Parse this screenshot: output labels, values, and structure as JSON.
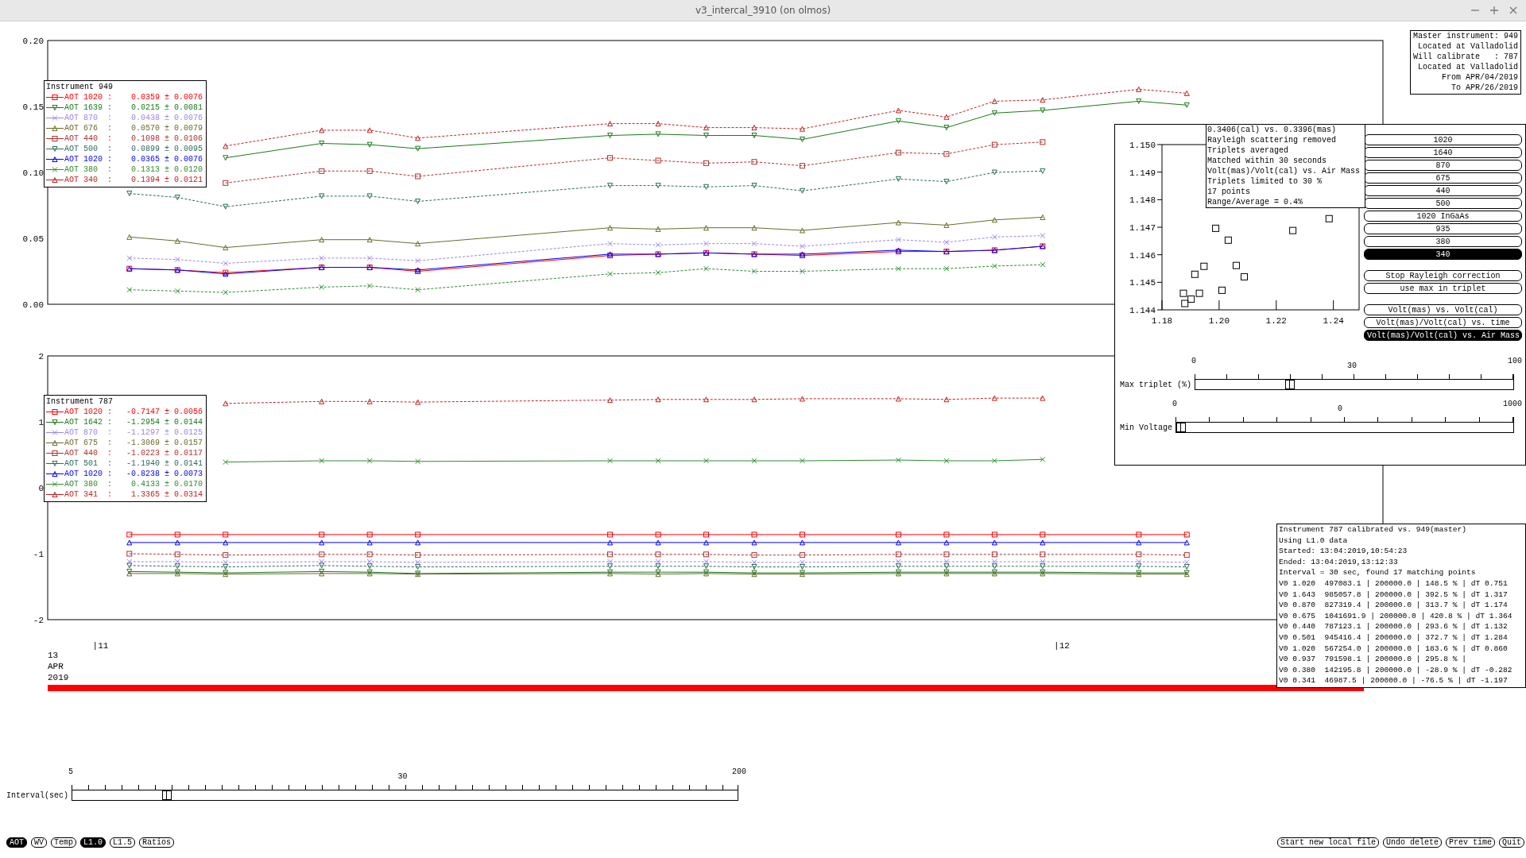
{
  "window": {
    "title": "v3_intercal_3910 (on olmos)"
  },
  "top_plot": {
    "chart_data": {
      "type": "line",
      "xlim": [
        10.945,
        12.334
      ],
      "ylim": [
        0,
        0.2
      ],
      "yticks": [
        {
          "value": 0,
          "label": "0.00"
        },
        {
          "value": 0.05,
          "label": "0.05"
        },
        {
          "value": 0.1,
          "label": "0.10"
        },
        {
          "value": 0.15,
          "label": "0.15"
        },
        {
          "value": 0.2,
          "label": "0.20"
        }
      ],
      "x": [
        11.03,
        11.08,
        11.13,
        11.23,
        11.28,
        11.33,
        11.53,
        11.58,
        11.63,
        11.68,
        11.73,
        11.83,
        11.88,
        11.93,
        11.98,
        12.08,
        12.13
      ],
      "series": [
        {
          "name": "AOT 1020",
          "color": "#ff0000",
          "marker": "square",
          "line_style": "solid",
          "values": [
            0.027,
            0.026,
            0.024,
            0.028,
            0.028,
            0.025,
            0.037,
            0.038,
            0.039,
            0.038,
            0.037,
            0.04,
            0.04,
            0.041,
            0.044,
            null,
            null
          ]
        },
        {
          "name": "AOT 1639",
          "color": "#1a7a1a",
          "marker": "triangle_down",
          "line_style": "solid",
          "values": [
            null,
            null,
            0.111,
            0.122,
            0.121,
            0.118,
            0.128,
            0.129,
            0.128,
            0.128,
            0.125,
            0.139,
            0.134,
            0.145,
            0.147,
            0.154,
            0.151
          ]
        },
        {
          "name": "AOT 870",
          "color": "#9b84ee",
          "marker": "x",
          "line_style": "dashed",
          "values": [
            0.035,
            0.034,
            0.031,
            0.035,
            0.035,
            0.033,
            0.046,
            0.045,
            0.046,
            0.046,
            0.044,
            0.049,
            0.047,
            0.051,
            0.052,
            null,
            null
          ]
        },
        {
          "name": "AOT 676",
          "color": "#6b6b2b",
          "marker": "triangle_up",
          "line_style": "solid",
          "values": [
            0.051,
            0.048,
            0.043,
            0.049,
            0.049,
            0.046,
            0.058,
            0.057,
            0.058,
            0.058,
            0.056,
            0.062,
            0.06,
            0.064,
            0.066,
            null,
            null
          ]
        },
        {
          "name": "AOT 440",
          "color": "#b03030",
          "marker": "square",
          "line_style": "dashed",
          "values": [
            null,
            null,
            0.092,
            0.101,
            0.101,
            0.097,
            0.111,
            0.109,
            0.107,
            0.108,
            0.105,
            0.115,
            0.114,
            0.121,
            0.123,
            null,
            null
          ]
        },
        {
          "name": "AOT 500",
          "color": "#2d6b5a",
          "marker": "triangle_down",
          "line_style": "dashed",
          "values": [
            0.084,
            0.081,
            0.074,
            0.082,
            0.082,
            0.078,
            0.09,
            0.09,
            0.089,
            0.09,
            0.086,
            0.095,
            0.093,
            0.1,
            0.101,
            null,
            null
          ]
        },
        {
          "name": "AOT 1020",
          "color": "#0000ff",
          "marker": "triangle_up",
          "line_style": "solid",
          "values": [
            0.027,
            0.026,
            0.023,
            0.028,
            0.028,
            0.026,
            0.038,
            0.038,
            0.039,
            0.038,
            0.038,
            0.041,
            0.04,
            0.041,
            0.044,
            null,
            null
          ]
        },
        {
          "name": "AOT 380",
          "color": "#2e8b2e",
          "marker": "x",
          "line_style": "dashed",
          "values": [
            0.011,
            0.01,
            0.009,
            0.013,
            0.014,
            0.011,
            0.023,
            0.024,
            0.027,
            0.025,
            0.025,
            0.027,
            0.027,
            0.029,
            0.03,
            null,
            null
          ]
        },
        {
          "name": "AOT 340",
          "color": "#c02020",
          "marker": "triangle_up",
          "line_style": "dashed",
          "values": [
            null,
            null,
            0.12,
            0.132,
            0.132,
            0.126,
            0.137,
            0.137,
            0.134,
            0.134,
            0.133,
            0.147,
            0.142,
            0.154,
            0.155,
            0.163,
            0.16
          ]
        }
      ]
    },
    "legend": {
      "title": "Instrument 949",
      "entries": [
        {
          "separator": ":",
          "value": "0.0359 ± 0.0076"
        },
        {
          "separator": ":",
          "value": "0.0215 ± 0.0081"
        },
        {
          "separator": ":",
          "value": "0.0438 ± 0.0076"
        },
        {
          "separator": ":",
          "value": "0.0570 ± 0.0079"
        },
        {
          "separator": ":",
          "value": "0.1098 ± 0.0106"
        },
        {
          "separator": ":",
          "value": "0.0899 ± 0.0095"
        },
        {
          "separator": ":",
          "value": "0.0365 ± 0.0076"
        },
        {
          "separator": ":",
          "value": "0.1313 ± 0.0120"
        },
        {
          "separator": ":",
          "value": "0.1394 ± 0.0121"
        }
      ]
    }
  },
  "bottom_plot": {
    "chart_data": {
      "type": "line",
      "xlim": [
        10.945,
        12.334
      ],
      "ylim": [
        -2,
        2
      ],
      "yticks": [
        -2,
        -1,
        0,
        1,
        2
      ],
      "xticks": [
        {
          "value": 11,
          "label": "|11"
        },
        {
          "value": 12,
          "label": "|12"
        }
      ],
      "x": [
        11.03,
        11.08,
        11.13,
        11.23,
        11.28,
        11.33,
        11.53,
        11.58,
        11.63,
        11.68,
        11.73,
        11.83,
        11.88,
        11.93,
        11.98,
        12.08,
        12.13
      ],
      "series": [
        {
          "name": "AOT 1020",
          "color": "#ff0000",
          "marker": "square",
          "line_style": "solid",
          "values": [
            -0.71,
            -0.71,
            -0.71,
            -0.71,
            -0.71,
            -0.71,
            -0.71,
            -0.71,
            -0.71,
            -0.71,
            -0.71,
            -0.71,
            -0.71,
            -0.71,
            -0.71,
            -0.71,
            -0.71
          ]
        },
        {
          "name": "AOT 1642",
          "color": "#1a7a1a",
          "marker": "triangle_down",
          "line_style": "solid",
          "values": [
            -1.27,
            -1.28,
            -1.29,
            -1.27,
            -1.28,
            -1.3,
            -1.28,
            -1.28,
            -1.28,
            -1.29,
            -1.29,
            -1.28,
            -1.28,
            -1.28,
            -1.28,
            -1.29,
            -1.29
          ]
        },
        {
          "name": "AOT 870",
          "color": "#9b84ee",
          "marker": "x",
          "line_style": "dashed",
          "values": [
            -1.12,
            -1.12,
            -1.13,
            -1.12,
            -1.12,
            -1.13,
            -1.12,
            -1.12,
            -1.12,
            -1.13,
            -1.13,
            -1.12,
            -1.12,
            -1.12,
            -1.12,
            -1.12,
            -1.13
          ]
        },
        {
          "name": "AOT 675",
          "color": "#6b6b2b",
          "marker": "triangle_up",
          "line_style": "solid",
          "values": [
            -1.3,
            -1.3,
            -1.31,
            -1.3,
            -1.3,
            -1.31,
            -1.3,
            -1.31,
            -1.3,
            -1.31,
            -1.31,
            -1.3,
            -1.3,
            -1.3,
            -1.3,
            -1.31,
            -1.31
          ]
        },
        {
          "name": "AOT 440",
          "color": "#b03030",
          "marker": "square",
          "line_style": "dashed",
          "values": [
            -1.0,
            -1.01,
            -1.02,
            -1.01,
            -1.01,
            -1.02,
            -1.01,
            -1.01,
            -1.01,
            -1.02,
            -1.02,
            -1.01,
            -1.01,
            -1.01,
            -1.01,
            -1.01,
            -1.02
          ]
        },
        {
          "name": "AOT 501",
          "color": "#2d6b5a",
          "marker": "triangle_down",
          "line_style": "dashed",
          "values": [
            -1.18,
            -1.19,
            -1.2,
            -1.18,
            -1.19,
            -1.2,
            -1.19,
            -1.19,
            -1.19,
            -1.2,
            -1.2,
            -1.19,
            -1.19,
            -1.19,
            -1.19,
            -1.19,
            -1.2
          ]
        },
        {
          "name": "AOT 1020",
          "color": "#0000ff",
          "marker": "triangle_up",
          "line_style": "solid",
          "values": [
            -0.83,
            -0.83,
            -0.83,
            -0.83,
            -0.83,
            -0.83,
            -0.83,
            -0.83,
            -0.83,
            -0.83,
            -0.83,
            -0.83,
            -0.83,
            -0.83,
            -0.83,
            -0.83,
            -0.83
          ]
        },
        {
          "name": "AOT 380",
          "color": "#2e8b2e",
          "marker": "x",
          "line_style": "solid",
          "values": [
            null,
            null,
            0.39,
            0.41,
            0.41,
            0.4,
            0.41,
            0.41,
            0.41,
            0.41,
            0.41,
            0.42,
            0.41,
            0.41,
            0.43,
            null,
            null
          ]
        },
        {
          "name": "AOT 341",
          "color": "#c02020",
          "marker": "triangle_up",
          "line_style": "dashed",
          "values": [
            null,
            null,
            1.28,
            1.31,
            1.31,
            1.3,
            1.33,
            1.34,
            1.34,
            1.34,
            1.35,
            1.35,
            1.34,
            1.36,
            1.36,
            null,
            null
          ]
        }
      ]
    },
    "legend": {
      "title": "Instrument 787",
      "entries": [
        {
          "separator": ":",
          "value": "-0.7147 ± 0.0056"
        },
        {
          "separator": ":",
          "value": "-1.2954 ± 0.0144"
        },
        {
          "separator": ":",
          "value": "-1.1297 ± 0.0125"
        },
        {
          "separator": ":",
          "value": "-1.3069 ± 0.0157"
        },
        {
          "separator": ":",
          "value": "-1.0223 ± 0.0117"
        },
        {
          "separator": ":",
          "value": "-1.1940 ± 0.0141"
        },
        {
          "separator": ":",
          "value": "-0.8238 ± 0.0073"
        },
        {
          "separator": ":",
          "value": "0.4133 ± 0.0170"
        },
        {
          "separator": ":",
          "value": "1.3365 ± 0.0314"
        }
      ]
    },
    "date_label": [
      "13",
      "APR",
      "2019"
    ]
  },
  "master_info": {
    "lines": [
      "Master instrument: 949",
      "Located at Valladolid",
      "Will calibrate   : 787",
      "Located at Valladolid",
      "From APR/04/2019",
      "To APR/26/2019"
    ]
  },
  "comparison_panel": {
    "chart_data": {
      "type": "scatter",
      "xlim": [
        1.18,
        1.249
      ],
      "ylim": [
        1.144,
        1.15
      ],
      "xticks": [
        {
          "value": 1.18,
          "label": "1.18"
        },
        {
          "value": 1.2,
          "label": "1.20"
        },
        {
          "value": 1.22,
          "label": "1.22"
        },
        {
          "value": 1.24,
          "label": "1.24"
        }
      ],
      "yticks": [
        {
          "value": 1.144,
          "label": "1.144"
        },
        {
          "value": 1.145,
          "label": "1.145"
        },
        {
          "value": 1.146,
          "label": "1.146"
        },
        {
          "value": 1.147,
          "label": "1.147"
        },
        {
          "value": 1.148,
          "label": "1.148"
        },
        {
          "value": 1.149,
          "label": "1.149"
        },
        {
          "value": 1.15,
          "label": "1.150"
        }
      ],
      "x": [
        1.1988,
        1.2032,
        1.2258,
        1.2385,
        1.1947,
        1.1915,
        1.206,
        1.2088,
        1.1875,
        1.1931,
        1.201,
        1.1902,
        1.188
      ],
      "series": [
        {
          "color": "#000000",
          "values": [
            1.14696,
            1.14653,
            1.14688,
            1.14731,
            1.14558,
            1.14529,
            1.14561,
            1.1452,
            1.1446,
            1.1446,
            1.14471,
            1.14439,
            1.14423
          ]
        }
      ]
    },
    "info_lines": [
      "0.3406(cal) vs. 0.3396(mas)",
      "Rayleigh scattering removed",
      "Triplets averaged",
      "Matched within 30 seconds",
      "Volt(mas)/Volt(cal) vs. Air Mass",
      "Triplets limited to 30 %",
      "17 points",
      "Range/Average = 0.4%"
    ],
    "wavelength_buttons": [
      {
        "label": "1020",
        "selected": false
      },
      {
        "label": "1640",
        "selected": false
      },
      {
        "label": "870",
        "selected": false
      },
      {
        "label": "675",
        "selected": false
      },
      {
        "label": "440",
        "selected": false
      },
      {
        "label": "500",
        "selected": false
      },
      {
        "label": "1020 InGaAs",
        "selected": false
      },
      {
        "label": "935",
        "selected": false
      },
      {
        "label": "380",
        "selected": false
      },
      {
        "label": "340",
        "selected": true
      }
    ],
    "option_buttons": [
      {
        "label": "Stop Rayleigh correction"
      },
      {
        "label": "use max in triplet"
      }
    ],
    "plot_buttons": [
      {
        "label": "Volt(mas) vs. Volt(cal)",
        "selected": false
      },
      {
        "label": "Volt(mas)/Volt(cal) vs. time",
        "selected": false
      },
      {
        "label": "Volt(mas)/Volt(cal) vs. Air Mass",
        "selected": true
      }
    ],
    "sliders": [
      {
        "label": "Max triplet (%)",
        "min_label": "0",
        "value_label": "30",
        "max_label": "100",
        "level": 0.29
      },
      {
        "label": "Min Voltage",
        "min_label": "0",
        "value_label": "0",
        "max_label": "1000",
        "level": 0.0
      }
    ]
  },
  "calibration_info": {
    "lines": [
      "Instrument 787 calibrated vs. 949(master)",
      "Using L1.0 data",
      "Started: 13:04:2019,10:54:23",
      "Ended: 13:04:2019,13:12:33",
      "Interval = 30 sec, found 17 matching points",
      "V0 1.020  497083.1 | 200000.0 | 148.5 % | dT 0.751",
      "V0 1.643  985057.8 | 200000.0 | 392.5 % | dT 1.317",
      "V0 0.870  827319.4 | 200000.0 | 313.7 % | dT 1.174",
      "V0 0.675  1041691.9 | 200000.0 | 420.8 % | dT 1.364",
      "V0 0.440  787123.1 | 200000.0 | 293.6 % | dT 1.132",
      "V0 0.501  945416.4 | 200000.0 | 372.7 % | dT 1.284",
      "V0 1.020  567254.0 | 200000.0 | 183.6 % | dT 0.860",
      "V0 0.937  791598.1 | 200000.0 | 295.8 % |",
      "V0 0.380  142195.8 | 200000.0 | -28.9 % | dT -0.282",
      "V0 0.341  46987.5 | 200000.0 | -76.5 % | dT -1.197"
    ]
  },
  "interval_slider": {
    "label": "Interval(sec)",
    "min_label": "5",
    "value_label": "30",
    "max_label": "200",
    "level": 0.137
  },
  "mode_buttons": [
    {
      "label": "AOT",
      "selected": true
    },
    {
      "label": "WV",
      "selected": false
    },
    {
      "label": "Temp",
      "selected": false
    },
    {
      "label": "L1.0",
      "selected": true
    },
    {
      "label": "L1.5",
      "selected": false
    },
    {
      "label": "Ratios",
      "selected": false
    }
  ],
  "action_buttons": [
    "Start new local file",
    "Undo delete",
    "Prev time",
    "Quit"
  ]
}
